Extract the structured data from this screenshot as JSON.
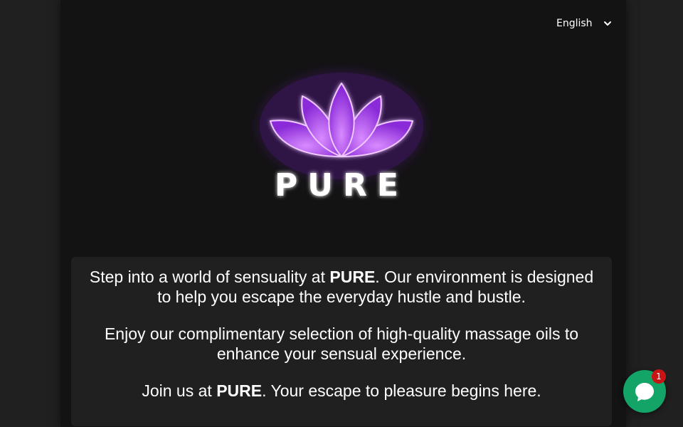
{
  "language_selector": {
    "selected": "English",
    "icon": "chevron-down-icon"
  },
  "logo": {
    "icon": "lotus-icon",
    "text": "PURE",
    "accent_color": "#b44cff"
  },
  "intro": {
    "p1_before": "Step into a world of sensuality at ",
    "p1_brand": "PURE",
    "p1_after": ". Our environment is designed to help you escape the everyday hustle and bustle.",
    "p2": "Enjoy our complimentary selection of high-quality massage oils to enhance your sensual experience.",
    "p3_before": "Join us at ",
    "p3_brand": "PURE",
    "p3_after": ". Your escape to pleasure begins here."
  },
  "chat": {
    "icon": "chat-bubble-icon",
    "badge_count": "1",
    "button_color": "#13a467",
    "badge_color": "#c81414"
  }
}
